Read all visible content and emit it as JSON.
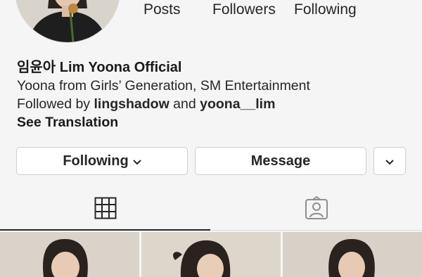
{
  "profile": {
    "stats": {
      "posts_label": "Posts",
      "followers_label": "Followers",
      "following_label": "Following"
    },
    "name": "임윤아 Lim Yoona Official",
    "bio_line": "Yoona from Girls’ Generation, SM Entertainment",
    "followed_by_prefix": "Followed by",
    "followed_by_user1": "lingshadow",
    "followed_by_and": "and",
    "followed_by_user2": "yoona__lim",
    "see_translation": "See Translation"
  },
  "actions": {
    "following_label": "Following",
    "message_label": "Message"
  },
  "tabs": [
    {
      "icon": "grid-icon",
      "active": true
    },
    {
      "icon": "tagged-icon",
      "active": false
    }
  ],
  "colors": {
    "background": "#f5f5f5",
    "text": "#262626",
    "button_border": "#cfcfcf"
  }
}
